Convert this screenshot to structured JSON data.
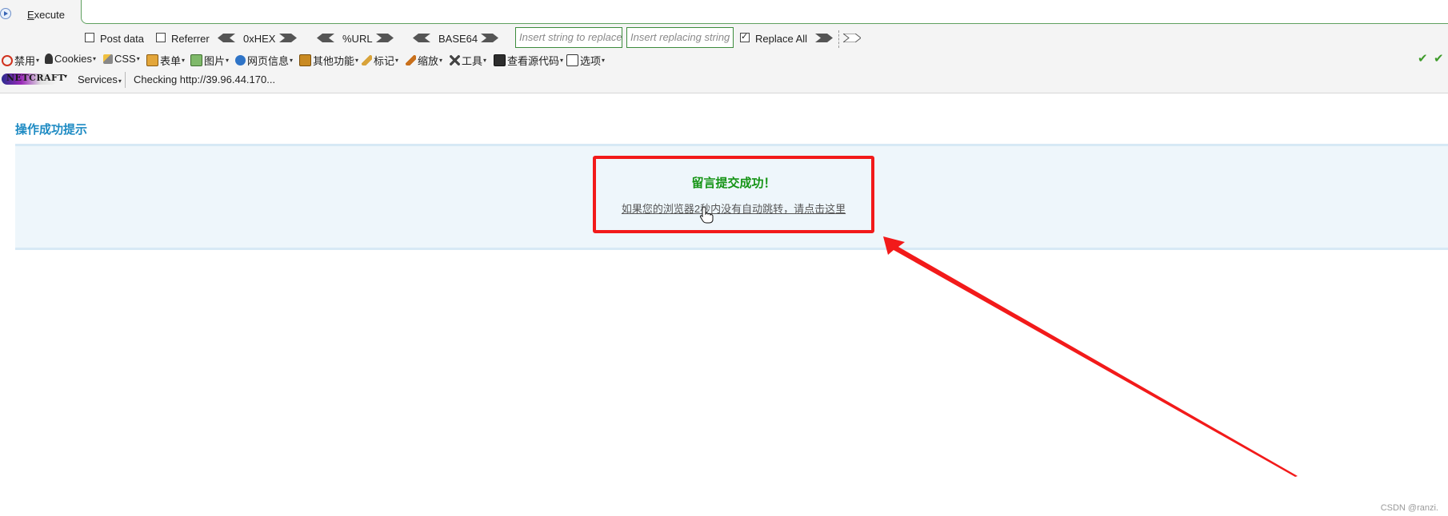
{
  "hackbar": {
    "execute_label_prefix": "E",
    "execute_label_rest": "xecute",
    "post_data_label": "Post data",
    "referrer_label": "Referrer",
    "hex_label": "0xHEX",
    "url_label": "%URL",
    "base64_label": "BASE64",
    "replace_string_placeholder": "Insert string to replace",
    "replacing_string_placeholder": "Insert replacing string",
    "replace_all_label": "Replace All",
    "post_data_checked": false,
    "referrer_checked": false,
    "replace_all_checked": true
  },
  "addon_toolbar": {
    "items": [
      {
        "label": "禁用",
        "icon": "disable-icon"
      },
      {
        "label": "Cookies",
        "icon": "cookie-icon"
      },
      {
        "label": "CSS",
        "icon": "css-icon"
      },
      {
        "label": "表单",
        "icon": "form-icon"
      },
      {
        "label": "图片",
        "icon": "image-icon"
      },
      {
        "label": "网页信息",
        "icon": "info-icon"
      },
      {
        "label": "其他功能",
        "icon": "misc-icon"
      },
      {
        "label": "标记",
        "icon": "pencil-icon"
      },
      {
        "label": "缩放",
        "icon": "zoom-icon"
      },
      {
        "label": "工具",
        "icon": "tools-icon"
      },
      {
        "label": "查看源代码",
        "icon": "source-icon"
      },
      {
        "label": "选项",
        "icon": "options-icon"
      }
    ]
  },
  "netcraft": {
    "logo_text": "NETCRAFT",
    "services_label": "Services",
    "checking_text": "Checking http://39.96.44.170..."
  },
  "page": {
    "heading": "操作成功提示",
    "message_title": "留言提交成功！",
    "message_link": "如果您的浏览器2秒内没有自动跳转，请点击这里"
  },
  "watermark": "CSDN @ranzi.",
  "colors": {
    "highlight_border": "#f21a1a",
    "arrow": "#f21a1a",
    "heading": "#1e8bc3",
    "success_text": "#159415"
  }
}
